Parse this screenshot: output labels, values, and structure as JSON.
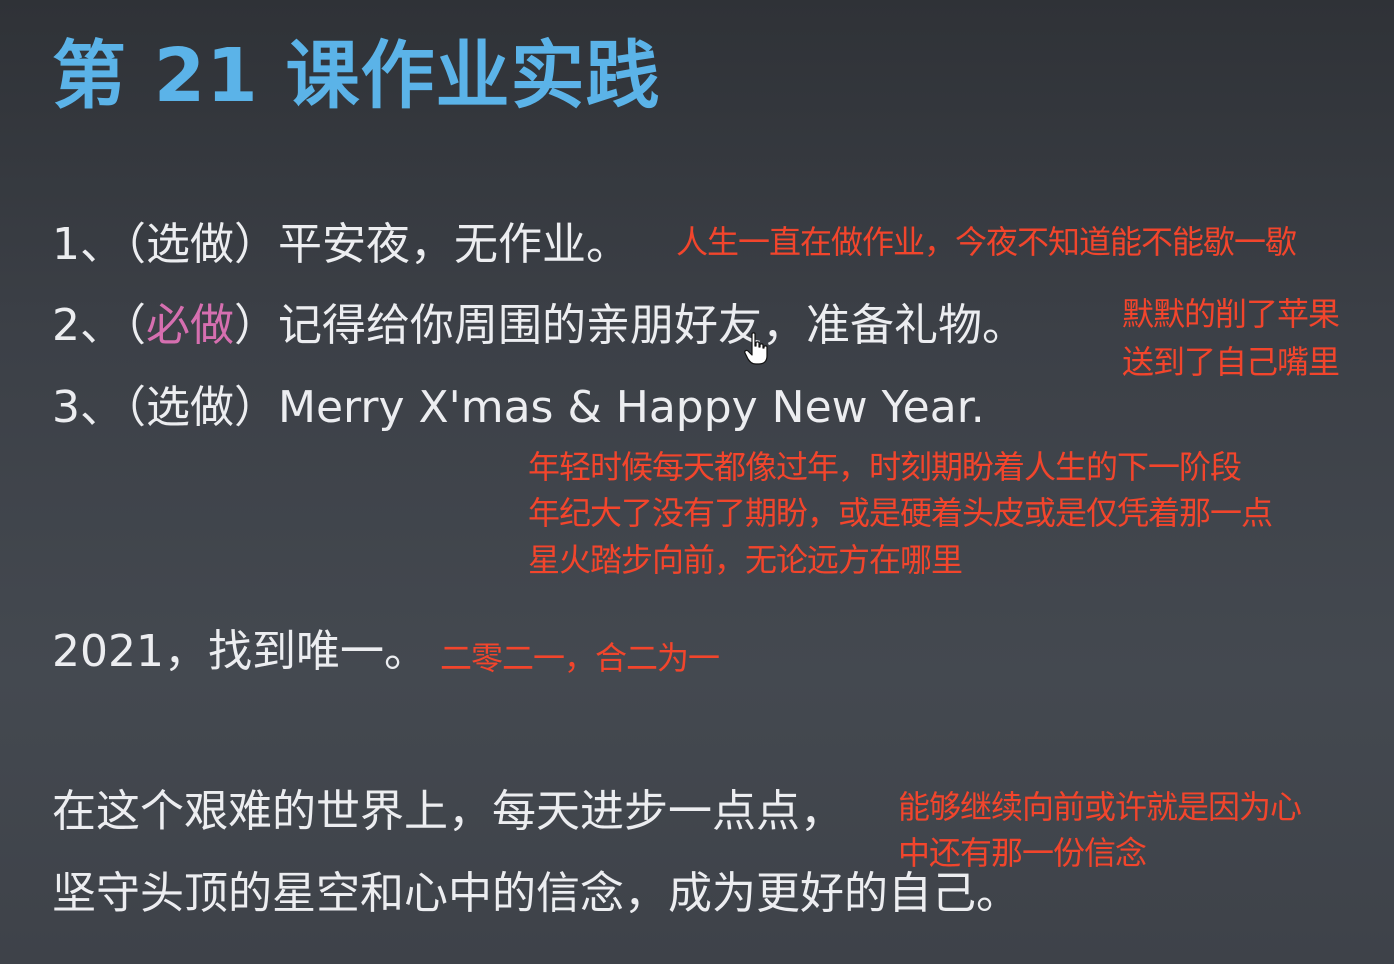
{
  "slide": {
    "title": "第 21 课作业实践",
    "items": [
      {
        "num": "1、",
        "tag_open": "（",
        "tag": "选做",
        "tag_close": "）",
        "text": "平安夜，无作业。"
      },
      {
        "num": "2、",
        "tag_open": "（",
        "tag": "必做",
        "tag_close": "）",
        "text": "记得给你周围的亲朋好友，准备礼物。"
      },
      {
        "num": "3、",
        "tag_open": "（",
        "tag": "选做",
        "tag_close": "）",
        "text": "Merry X'mas & Happy New Year."
      }
    ],
    "year_line": "2021，找到唯一。",
    "closing": [
      "在这个艰难的世界上，每天进步一点点，",
      "坚守头顶的星空和心中的信念，成为更好的自己。"
    ]
  },
  "annotations": {
    "note1": "人生一直在做作业，今夜不知道能不能歇一歇",
    "note2": [
      "默默的削了苹果",
      "送到了自己嘴里"
    ],
    "note3": [
      "年轻时候每天都像过年，时刻期盼着人生的下一阶段",
      "年纪大了没有了期盼，或是硬着头皮或是仅凭着那一点",
      "星火踏步向前，无论远方在哪里"
    ],
    "note4": "二零二一，合二为一",
    "note5": [
      "能够继续向前或许就是因为心",
      "中还有那一份信念"
    ]
  },
  "colors": {
    "title": "#5bb3e8",
    "text": "#ecedf0",
    "required_tag": "#d66fb0",
    "annotation": "#f2452c",
    "background": "#3c4047"
  },
  "cursor_icon": "hand-pointer-icon"
}
